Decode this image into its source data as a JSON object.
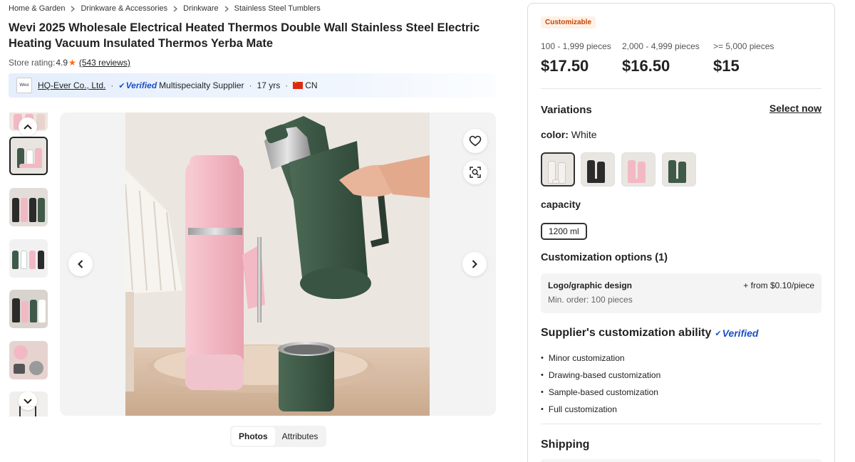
{
  "breadcrumb": [
    "Home & Garden",
    "Drinkware & Accessories",
    "Drinkware",
    "Stainless Steel Tumblers"
  ],
  "product": {
    "title": "Wevi 2025 Wholesale Electrical Heated Thermos Double Wall Stainless Steel Electric Heating Vacuum Insulated Thermos Yerba Mate"
  },
  "rating": {
    "label": "Store rating:",
    "score": "4.9",
    "reviews": "(543 reviews)"
  },
  "supplier": {
    "logo_text": "Wevi",
    "name": "HQ-Ever Co., Ltd.",
    "verified_label": "Verified",
    "type": "Multispecialty Supplier",
    "years": "17 yrs",
    "country": "CN"
  },
  "gallery": {
    "tabs": [
      "Photos",
      "Attributes"
    ],
    "active_tab": "Photos",
    "thumbnail_count": 7,
    "selected_thumbnail": 1,
    "thumb_icon": "chevron-up-icon / chevron-down-icon",
    "image_icons": [
      "heart-icon",
      "image-search-icon",
      "chevron-left-icon",
      "chevron-right-icon"
    ]
  },
  "pricing": {
    "badge": "Customizable",
    "tiers": [
      {
        "range": "100 - 1,999 pieces",
        "price": "$17.50"
      },
      {
        "range": "2,000 - 4,999 pieces",
        "price": "$16.50"
      },
      {
        "range": ">= 5,000 pieces",
        "price": "$15"
      }
    ]
  },
  "variations": {
    "heading": "Variations",
    "select_now": "Select now",
    "color_label": "color:",
    "color_value": "White",
    "colors": [
      {
        "name": "White",
        "hex": "#f4f1ee"
      },
      {
        "name": "Black",
        "hex": "#2b2b2b"
      },
      {
        "name": "Pink",
        "hex": "#f2b9c4"
      },
      {
        "name": "Green",
        "hex": "#3f5a48"
      }
    ],
    "capacity_label": "capacity",
    "capacity_value": "1200 ml"
  },
  "customization": {
    "heading": "Customization options (1)",
    "option_name": "Logo/graphic design",
    "min_order": "Min. order: 100 pieces",
    "fee": "+ from $0.10/piece"
  },
  "ability": {
    "heading": "Supplier's customization ability",
    "verified_label": "Verified",
    "items": [
      "Minor customization",
      "Drawing-based customization",
      "Sample-based customization",
      "Full customization"
    ]
  },
  "shipping": {
    "heading": "Shipping"
  },
  "colors": {
    "accent": "#ff6a00",
    "verified_blue": "#1b4fc5",
    "badge_text": "#c54500",
    "badge_bg": "#fff1e6"
  }
}
